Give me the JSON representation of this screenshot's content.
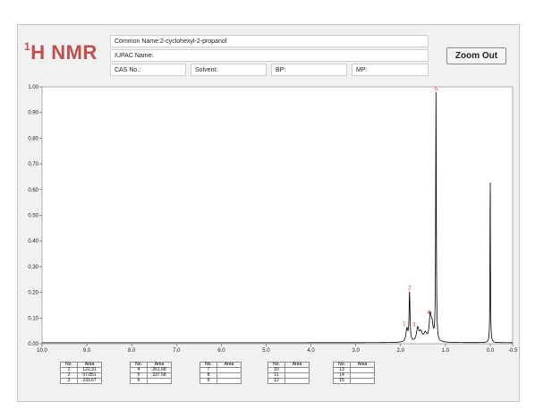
{
  "header": {
    "title_sup": "1",
    "title_main": "H NMR",
    "common_name_label": "Common Name:",
    "common_name_value": "2-cyclohexyl-2-propanol",
    "iupac_label": "IUPAC Name:",
    "iupac_value": "",
    "cas_label": "CAS No.:",
    "solvent_label": "Solvent:",
    "bp_label": "BP:",
    "mp_label": "MP:"
  },
  "toolbar": {
    "zoom_out_label": "Zoom Out"
  },
  "chart_data": {
    "type": "line",
    "y_ticks": [
      "0.00",
      "0.10",
      "0.20",
      "0.30",
      "0.40",
      "0.50",
      "0.60",
      "0.70",
      "0.80",
      "0.90",
      "1.00"
    ],
    "x_ticks": [
      "10.0",
      "9.0",
      "8.0",
      "7.0",
      "6.0",
      "5.0",
      "4.0",
      "3.0",
      "2.0",
      "1.0",
      "0.0",
      "-0.5"
    ],
    "xlim": [
      10.0,
      -0.5
    ],
    "ylim": [
      0,
      1.0
    ],
    "peaks": [
      {
        "label": "1",
        "ppm": 1.86,
        "height": 0.05
      },
      {
        "label": "2",
        "ppm": 1.8,
        "height": 0.19
      },
      {
        "label": "3",
        "ppm": 1.62,
        "height": 0.05
      },
      {
        "label": "4",
        "ppm": 1.34,
        "height": 0.09
      },
      {
        "label": "5",
        "ppm": 1.21,
        "height": 0.97
      },
      {
        "label": "",
        "ppm": 0.0,
        "height": 0.65
      }
    ]
  },
  "area_tables": [
    {
      "header": [
        "No.",
        "Area"
      ],
      "rows": [
        [
          "1",
          "122.31"
        ],
        [
          "2",
          "57.851"
        ],
        [
          "3",
          "233.67"
        ]
      ]
    },
    {
      "header": [
        "No.",
        "Area"
      ],
      "rows": [
        [
          "4",
          "261.68"
        ],
        [
          "5",
          "337.58"
        ],
        [
          "6",
          ""
        ]
      ]
    },
    {
      "header": [
        "No.",
        "Area"
      ],
      "rows": [
        [
          "7",
          ""
        ],
        [
          "8",
          ""
        ],
        [
          "9",
          ""
        ]
      ]
    },
    {
      "header": [
        "No.",
        "Area"
      ],
      "rows": [
        [
          "10",
          ""
        ],
        [
          "11",
          ""
        ],
        [
          "12",
          ""
        ]
      ]
    },
    {
      "header": [
        "No.",
        "Area"
      ],
      "rows": [
        [
          "13",
          ""
        ],
        [
          "14",
          ""
        ],
        [
          "15",
          ""
        ]
      ]
    }
  ]
}
